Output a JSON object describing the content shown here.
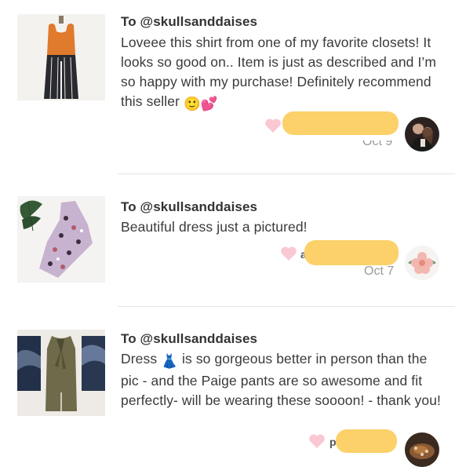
{
  "reviews": [
    {
      "recipient": "To @skullsanddaises",
      "text_pre": "Loveee this shirt from one of my favorite closets! It looks so good on.. Item is just as described and I’m so happy with my purchase! Definitely recommend this seller",
      "emoji": "🙂💕",
      "text_post": "",
      "date": "Oct 9",
      "reviewer_initial": "",
      "thumbnail_icon": "orange-tank-top-striped-pants-photo",
      "avatar_icon": "couple-photo-avatar"
    },
    {
      "recipient": "To @skullsanddaises",
      "text_pre": "Beautiful dress just a pictured!",
      "emoji": "",
      "text_post": "",
      "date": "Oct 7",
      "reviewer_initial": "a",
      "thumbnail_icon": "lavender-floral-dress-photo",
      "avatar_icon": "pink-flower-avatar"
    },
    {
      "recipient": "To @skullsanddaises",
      "text_pre": "Dress",
      "emoji": "👗",
      "text_post": "is so gorgeous better in person than the pic - and the Paige pants are so awesome and fit perfectly- will be wearing these soooon! - thank you!",
      "date": "",
      "reviewer_initial": "p",
      "thumbnail_icon": "olive-tie-neck-dress-photo",
      "avatar_icon": "food-photo-avatar"
    }
  ],
  "colors": {
    "heart": "#f9c8d2",
    "redaction": "#fcd16a",
    "divider": "#e4e4e4",
    "date": "#9a9a9a",
    "text": "#3a3a3a"
  }
}
